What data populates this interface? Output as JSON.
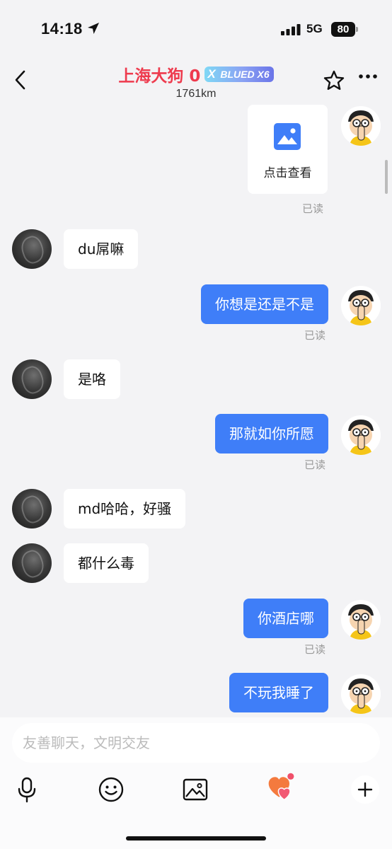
{
  "status_bar": {
    "time": "14:18",
    "network": "5G",
    "battery": "80",
    "icons": [
      "location-arrow-icon",
      "signal-bars-icon",
      "battery-icon"
    ]
  },
  "header": {
    "contact_name": "上海大狗 0",
    "vip_badge": "BLUED X6",
    "vip_badge_mark": "X",
    "distance": "1761km",
    "icons": [
      "back-chevron-icon",
      "star-icon",
      "more-dots-icon"
    ],
    "name_color": "#ee3b4e"
  },
  "messages": [
    {
      "side": "out",
      "type": "image",
      "label": "点击查看",
      "read": "已读"
    },
    {
      "side": "in",
      "text": "du屌嘛"
    },
    {
      "side": "out",
      "text": "你想是还是不是",
      "read": "已读"
    },
    {
      "side": "in",
      "text": "是咯"
    },
    {
      "side": "out",
      "text": "那就如你所愿",
      "read": "已读"
    },
    {
      "side": "in",
      "text": "md哈哈，好骚"
    },
    {
      "side": "in",
      "text": "都什么毒"
    },
    {
      "side": "out",
      "text": "你酒店哪",
      "read": "已读"
    },
    {
      "side": "out",
      "text": "不玩我睡了"
    }
  ],
  "composer": {
    "placeholder": "友善聊天，文明交友",
    "tools": [
      "microphone-icon",
      "emoji-icon",
      "image-icon",
      "heart-gift-icon",
      "plus-icon"
    ]
  },
  "colors": {
    "outgoing_bubble": "#3f7ef8",
    "incoming_bubble": "#ffffff",
    "background": "#f3f3f5",
    "notification_dot": "#f0506a"
  }
}
